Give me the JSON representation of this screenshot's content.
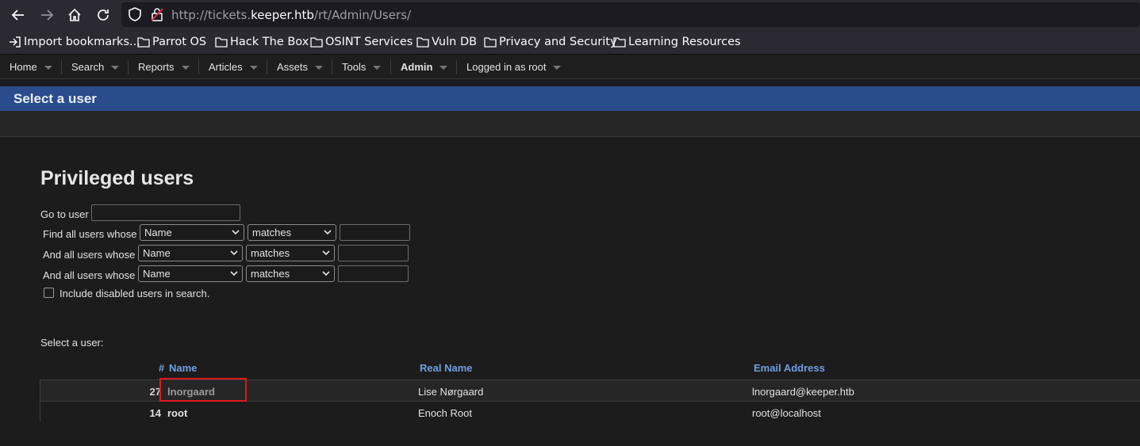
{
  "browser": {
    "url_prefix": "http://tickets.",
    "url_domain": "keeper.htb",
    "url_path": "/rt/Admin/Users/",
    "bookmarks": [
      "Import bookmarks...",
      "Parrot OS",
      "Hack The Box",
      "OSINT Services",
      "Vuln DB",
      "Privacy and Security",
      "Learning Resources"
    ]
  },
  "menu": {
    "items": [
      "Home",
      "Search",
      "Reports",
      "Articles",
      "Assets",
      "Tools",
      "Admin",
      "Logged in as root"
    ]
  },
  "page": {
    "title": "Select a user",
    "heading": "Privileged users",
    "goto_label": "Go to user",
    "find_rows": [
      {
        "label": "Find all users whose",
        "field": "Name",
        "op": "matches"
      },
      {
        "label": "And all users whose",
        "field": "Name",
        "op": "matches"
      },
      {
        "label": "And all users whose",
        "field": "Name",
        "op": "matches"
      }
    ],
    "include_disabled_label": "Include disabled users in search.",
    "select_label": "Select a user:",
    "columns": {
      "hash": "#",
      "name": "Name",
      "real_name": "Real Name",
      "email": "Email Address"
    },
    "users": [
      {
        "id": "27",
        "name": "lnorgaard",
        "real_name": "Lise Nørgaard",
        "email": "lnorgaard@keeper.htb"
      },
      {
        "id": "14",
        "name": "root",
        "real_name": "Enoch Root",
        "email": "root@localhost"
      }
    ]
  },
  "colors": {
    "accent": "#2a4c8d",
    "link": "#6f9fe0",
    "highlight": "#e0191d"
  }
}
